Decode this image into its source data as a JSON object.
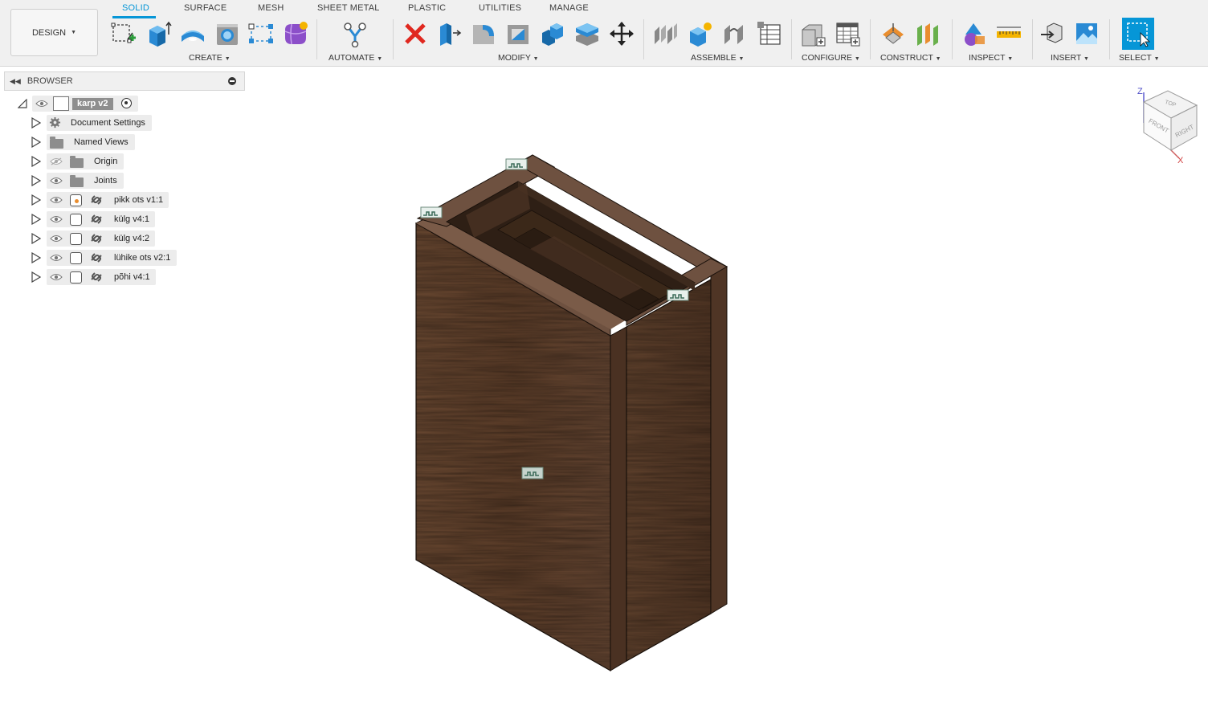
{
  "workspace": {
    "label": "DESIGN"
  },
  "tabs": [
    {
      "label": "SOLID",
      "active": true
    },
    {
      "label": "SURFACE"
    },
    {
      "label": "MESH"
    },
    {
      "label": "SHEET METAL"
    },
    {
      "label": "PLASTIC"
    },
    {
      "label": "UTILITIES"
    },
    {
      "label": "MANAGE"
    }
  ],
  "groups": {
    "create": "CREATE",
    "automate": "AUTOMATE",
    "modify": "MODIFY",
    "assemble": "ASSEMBLE",
    "configure": "CONFIGURE",
    "construct": "CONSTRUCT",
    "inspect": "INSPECT",
    "insert": "INSERT",
    "select": "SELECT"
  },
  "browser": {
    "title": "BROWSER",
    "root": "karp v2",
    "items": [
      {
        "label": "Document Settings",
        "icon": "gear-icon"
      },
      {
        "label": "Named Views",
        "icon": "folder-icon"
      },
      {
        "label": "Origin",
        "icon": "folder-icon",
        "hidden": true
      },
      {
        "label": "Joints",
        "icon": "folder-icon"
      },
      {
        "label": "pikk ots v1:1",
        "icon": "component-icon"
      },
      {
        "label": "külg v4:1",
        "icon": "component-icon"
      },
      {
        "label": "külg v4:2",
        "icon": "component-icon"
      },
      {
        "label": "lühike ots v2:1",
        "icon": "component-icon"
      },
      {
        "label": "põhi v4:1",
        "icon": "component-icon"
      }
    ]
  },
  "viewcube": {
    "top": "TOP",
    "front": "FRONT",
    "right": "RIGHT",
    "z": "Z",
    "x": "X"
  },
  "colors": {
    "accent": "#0696d7",
    "wood": "#5b3e2c",
    "wood_dark": "#3f2a1d"
  }
}
